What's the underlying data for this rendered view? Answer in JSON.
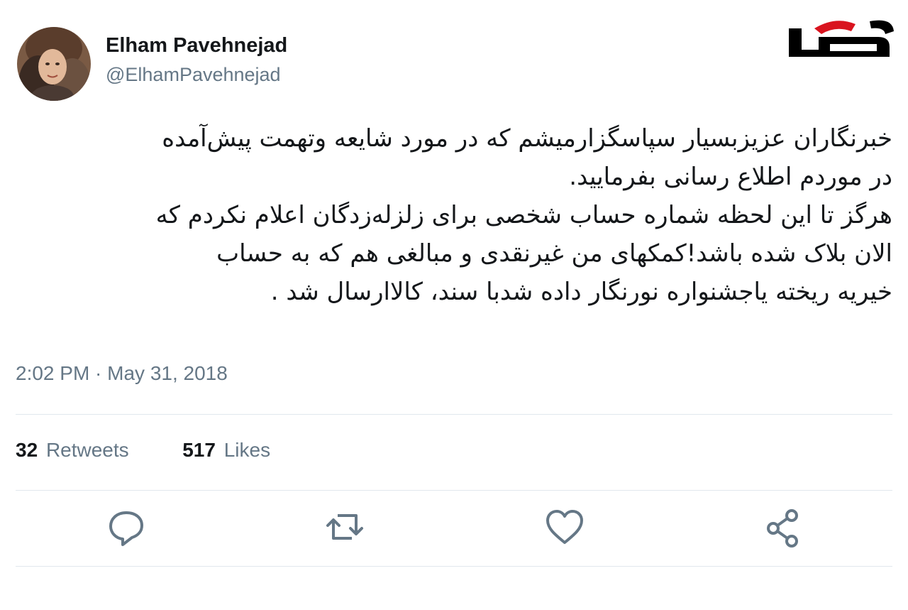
{
  "user": {
    "display_name": "Elham Pavehnejad",
    "handle": "@ElhamPavehnejad"
  },
  "logo": {
    "name": "rokna-logo",
    "color": "#000000",
    "accent": "#d9141f"
  },
  "tweet": {
    "lines": [
      "خبرنگاران عزیزبسیار سپاسگزارمیشم که در مورد شایعه وتهمت پیش‌آمده",
      "در موردم اطلاع رسانی بفرمایید.",
      "هرگز تا این لحظه شماره حساب شخصی برای زلزله‌زدگان اعلام نکردم که",
      "الان بلاک شده باشد!کمکهای من غیرنقدی و مبالغی هم که به حساب",
      "خیریه ریخته یاجشنواره نورنگار داده شدبا سند، کالاارسال شد ."
    ],
    "timestamp": "2:02 PM · May 31, 2018"
  },
  "stats": {
    "retweets_count": "32",
    "retweets_label": "Retweets",
    "likes_count": "517",
    "likes_label": "Likes"
  },
  "actions": [
    {
      "name": "reply-icon"
    },
    {
      "name": "retweet-icon"
    },
    {
      "name": "like-icon"
    },
    {
      "name": "share-icon"
    }
  ],
  "colors": {
    "text": "#14171a",
    "secondary": "#657786",
    "divider": "#e1e8ed",
    "icon": "#657786"
  }
}
